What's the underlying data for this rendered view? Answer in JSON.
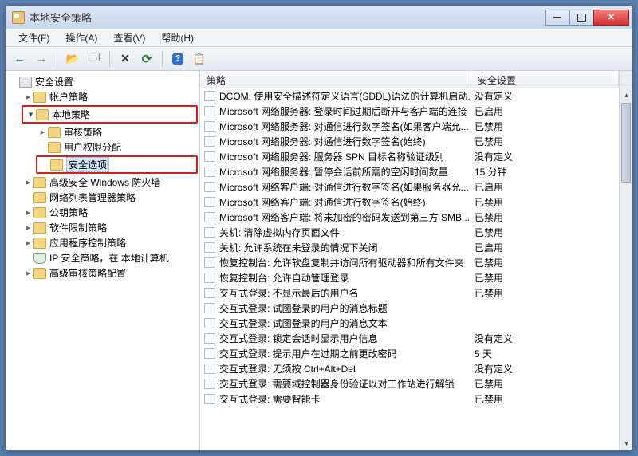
{
  "window": {
    "title": "本地安全策略"
  },
  "menu": {
    "file": "文件(F)",
    "action": "操作(A)",
    "view": "查看(V)",
    "help": "帮助(H)"
  },
  "tree": {
    "root": "安全设置",
    "account": "帐户策略",
    "local": "本地策略",
    "audit": "审核策略",
    "user_rights": "用户权限分配",
    "sec_options": "安全选项",
    "firewall": "高级安全 Windows 防火墙",
    "netlist": "网络列表管理器策略",
    "pubkey": "公钥策略",
    "swrestrict": "软件限制策略",
    "appctrl": "应用程序控制策略",
    "ipsec": "IP 安全策略，在 本地计算机",
    "advaudit": "高级审核策略配置"
  },
  "columns": {
    "policy": "策略",
    "setting": "安全设置"
  },
  "rows": [
    {
      "p": "DCOM: 使用安全描述符定义语言(SDDL)语法的计算机启动...",
      "s": "没有定义"
    },
    {
      "p": "Microsoft 网络服务器: 登录时间过期后断开与客户端的连接",
      "s": "已启用"
    },
    {
      "p": "Microsoft 网络服务器: 对通信进行数字签名(如果客户端允...",
      "s": "已禁用"
    },
    {
      "p": "Microsoft 网络服务器: 对通信进行数字签名(始终)",
      "s": "已禁用"
    },
    {
      "p": "Microsoft 网络服务器: 服务器 SPN 目标名称验证级别",
      "s": "没有定义"
    },
    {
      "p": "Microsoft 网络服务器: 暂停会话前所需的空闲时间数量",
      "s": "15 分钟"
    },
    {
      "p": "Microsoft 网络客户端: 对通信进行数字签名(如果服务器允...",
      "s": "已启用"
    },
    {
      "p": "Microsoft 网络客户端: 对通信进行数字签名(始终)",
      "s": "已禁用"
    },
    {
      "p": "Microsoft 网络客户端: 将未加密的密码发送到第三方 SMB...",
      "s": "已禁用"
    },
    {
      "p": "关机: 清除虚拟内存页面文件",
      "s": "已禁用"
    },
    {
      "p": "关机: 允许系统在未登录的情况下关闭",
      "s": "已启用"
    },
    {
      "p": "恢复控制台: 允许软盘复制并访问所有驱动器和所有文件夹",
      "s": "已禁用"
    },
    {
      "p": "恢复控制台: 允许自动管理登录",
      "s": "已禁用"
    },
    {
      "p": "交互式登录: 不显示最后的用户名",
      "s": "已禁用"
    },
    {
      "p": "交互式登录: 试图登录的用户的消息标题",
      "s": ""
    },
    {
      "p": "交互式登录: 试图登录的用户的消息文本",
      "s": ""
    },
    {
      "p": "交互式登录: 锁定会话时显示用户信息",
      "s": "没有定义"
    },
    {
      "p": "交互式登录: 提示用户在过期之前更改密码",
      "s": "5 天"
    },
    {
      "p": "交互式登录: 无须按 Ctrl+Alt+Del",
      "s": "没有定义"
    },
    {
      "p": "交互式登录: 需要域控制器身份验证以对工作站进行解锁",
      "s": "已禁用"
    },
    {
      "p": "交互式登录: 需要智能卡",
      "s": "已禁用"
    }
  ]
}
